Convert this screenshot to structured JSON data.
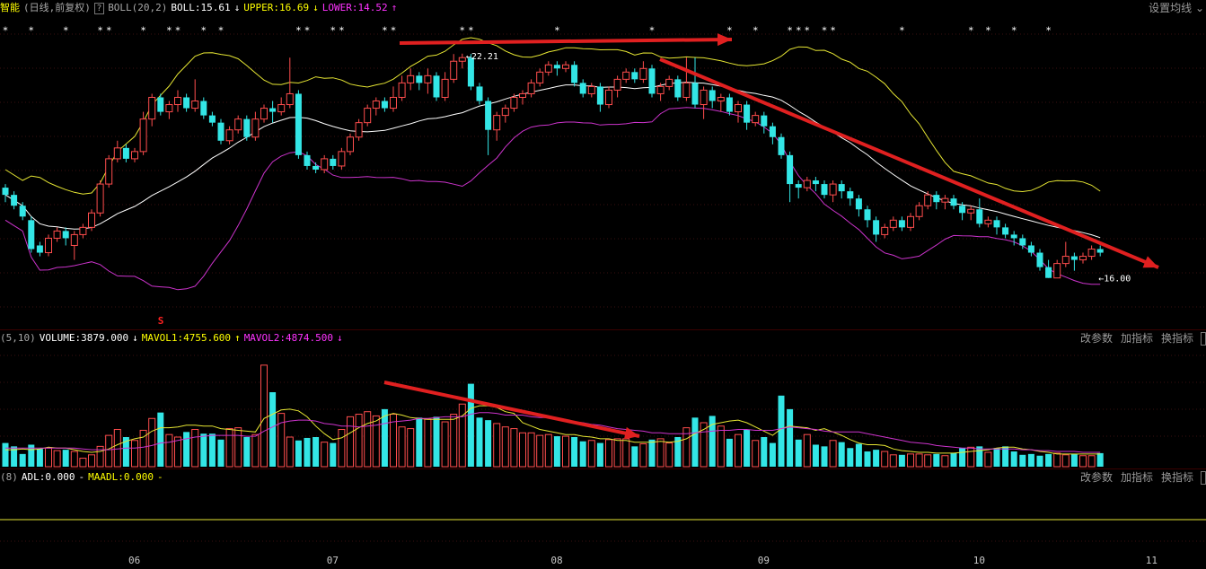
{
  "header": {
    "stock_name": "智能",
    "period": "(日线,前复权)",
    "help": "?",
    "indicator": "BOLL(20,2)",
    "boll": "BOLL:15.61",
    "boll_arrow": "↓",
    "upper": "UPPER:16.69",
    "upper_arrow": "↓",
    "lower": "LOWER:14.52",
    "lower_arrow": "↑",
    "settings": "设置均线"
  },
  "annotations": {
    "high_label": "22.21",
    "low_label": "16.00",
    "signal_mark": "S"
  },
  "volume_header": {
    "params": "(5,10)",
    "volume": "VOLUME:3879.000",
    "volume_arrow": "↓",
    "mavol1": "MAVOL1:4755.600",
    "mavol1_arrow": "↑",
    "mavol2": "MAVOL2:4874.500",
    "mavol2_arrow": "↓",
    "btn_params": "改参数",
    "btn_add": "加指标",
    "btn_switch": "换指标"
  },
  "adl_header": {
    "params": "(8)",
    "adl": "ADL:0.000",
    "dash1": "-",
    "maadl": "MAADL:0.000",
    "dash2": "-",
    "btn_params": "改参数",
    "btn_add": "加指标",
    "btn_switch": "换指标"
  },
  "x_axis": {
    "labels": [
      "06",
      "07",
      "08",
      "09",
      "10",
      "11"
    ]
  },
  "colors": {
    "up": "#ff4d4d",
    "down": "#33e6e6",
    "mid": "#ffffff",
    "upper": "#e6e633",
    "lower": "#cc33cc",
    "arrow": "#e02020",
    "star": "#ffffff"
  },
  "chart_data": {
    "type": "candlestick",
    "indicator": "BOLL(20,2)",
    "price_range": [
      14.8,
      23.0
    ],
    "high": 22.21,
    "low": 16.0,
    "candles": [
      [
        18.5,
        18.3,
        18.6,
        18.1
      ],
      [
        18.3,
        18.0,
        18.4,
        17.9
      ],
      [
        18.0,
        17.7,
        18.1,
        17.6
      ],
      [
        17.6,
        16.8,
        17.7,
        16.7
      ],
      [
        16.9,
        16.7,
        17.0,
        16.6
      ],
      [
        16.7,
        17.1,
        17.2,
        16.6
      ],
      [
        17.1,
        17.3,
        17.4,
        17.0
      ],
      [
        17.3,
        17.1,
        17.4,
        16.9
      ],
      [
        16.9,
        17.2,
        17.3,
        16.5
      ],
      [
        17.2,
        17.4,
        17.5,
        17.1
      ],
      [
        17.4,
        17.8,
        17.9,
        17.3
      ],
      [
        17.8,
        18.6,
        18.7,
        17.7
      ],
      [
        18.6,
        19.3,
        19.4,
        18.5
      ],
      [
        19.3,
        19.6,
        19.8,
        19.2
      ],
      [
        19.6,
        19.3,
        19.7,
        19.2
      ],
      [
        19.3,
        19.5,
        19.6,
        19.2
      ],
      [
        19.5,
        20.4,
        20.6,
        19.4
      ],
      [
        20.4,
        21.0,
        21.1,
        20.2
      ],
      [
        21.0,
        20.6,
        21.1,
        20.5
      ],
      [
        20.6,
        20.8,
        20.9,
        20.4
      ],
      [
        20.8,
        21.0,
        21.2,
        20.6
      ],
      [
        21.0,
        20.7,
        21.1,
        20.6
      ],
      [
        20.7,
        20.9,
        21.5,
        20.6
      ],
      [
        20.9,
        20.5,
        21.0,
        20.4
      ],
      [
        20.5,
        20.3,
        20.6,
        20.2
      ],
      [
        20.3,
        19.8,
        20.4,
        19.7
      ],
      [
        19.8,
        20.1,
        20.2,
        19.7
      ],
      [
        20.1,
        20.4,
        20.5,
        20.0
      ],
      [
        20.4,
        19.9,
        20.5,
        19.8
      ],
      [
        19.9,
        20.4,
        20.6,
        19.8
      ],
      [
        20.4,
        20.7,
        20.8,
        20.3
      ],
      [
        20.7,
        20.6,
        20.9,
        20.3
      ],
      [
        20.6,
        20.8,
        21.0,
        20.5
      ],
      [
        20.8,
        21.1,
        22.1,
        20.7
      ],
      [
        21.1,
        19.4,
        21.2,
        19.3
      ],
      [
        19.4,
        19.1,
        19.5,
        19.0
      ],
      [
        19.1,
        19.0,
        19.2,
        18.9
      ],
      [
        19.0,
        19.3,
        19.4,
        18.9
      ],
      [
        19.3,
        19.1,
        19.4,
        19.0
      ],
      [
        19.1,
        19.5,
        19.6,
        19.0
      ],
      [
        19.5,
        19.9,
        20.0,
        19.4
      ],
      [
        19.9,
        20.3,
        20.4,
        19.8
      ],
      [
        20.3,
        20.7,
        20.8,
        20.2
      ],
      [
        20.7,
        20.9,
        21.0,
        20.5
      ],
      [
        20.9,
        20.7,
        21.0,
        20.6
      ],
      [
        20.7,
        21.0,
        21.3,
        20.6
      ],
      [
        21.0,
        21.4,
        21.6,
        20.9
      ],
      [
        21.4,
        21.6,
        21.8,
        21.2
      ],
      [
        21.6,
        21.4,
        21.7,
        21.2
      ],
      [
        21.4,
        21.6,
        21.8,
        21.1
      ],
      [
        21.6,
        21.0,
        21.7,
        20.9
      ],
      [
        21.0,
        21.5,
        21.7,
        20.9
      ],
      [
        21.5,
        22.0,
        22.2,
        21.4
      ],
      [
        22.0,
        22.1,
        22.21,
        21.8
      ],
      [
        22.1,
        21.3,
        22.2,
        21.2
      ],
      [
        21.3,
        20.9,
        21.4,
        20.8
      ],
      [
        20.9,
        20.1,
        21.0,
        19.4
      ],
      [
        20.1,
        20.5,
        20.6,
        19.8
      ],
      [
        20.5,
        20.7,
        20.8,
        20.3
      ],
      [
        20.7,
        21.0,
        21.1,
        20.6
      ],
      [
        21.0,
        21.1,
        21.2,
        20.8
      ],
      [
        21.1,
        21.4,
        21.5,
        21.0
      ],
      [
        21.4,
        21.7,
        21.8,
        21.3
      ],
      [
        21.7,
        21.9,
        22.0,
        21.6
      ],
      [
        21.9,
        21.8,
        22.0,
        21.6
      ],
      [
        21.8,
        21.9,
        22.0,
        21.7
      ],
      [
        21.9,
        21.4,
        22.0,
        21.3
      ],
      [
        21.4,
        21.1,
        21.5,
        21.0
      ],
      [
        21.1,
        21.3,
        21.4,
        21.0
      ],
      [
        21.3,
        20.8,
        21.4,
        20.6
      ],
      [
        20.8,
        21.2,
        21.3,
        20.7
      ],
      [
        21.2,
        21.5,
        21.6,
        21.0
      ],
      [
        21.5,
        21.7,
        21.8,
        21.4
      ],
      [
        21.7,
        21.5,
        21.8,
        21.4
      ],
      [
        21.5,
        21.8,
        22.0,
        21.4
      ],
      [
        21.8,
        21.1,
        21.9,
        21.0
      ],
      [
        21.1,
        21.3,
        21.4,
        20.9
      ],
      [
        21.3,
        21.5,
        21.6,
        21.2
      ],
      [
        21.5,
        21.0,
        21.6,
        20.9
      ],
      [
        21.0,
        21.4,
        22.1,
        20.9
      ],
      [
        21.4,
        20.8,
        22.1,
        20.7
      ],
      [
        20.8,
        21.2,
        21.3,
        20.4
      ],
      [
        21.2,
        20.9,
        21.3,
        20.7
      ],
      [
        20.9,
        21.0,
        21.1,
        20.6
      ],
      [
        21.0,
        20.6,
        21.1,
        20.5
      ],
      [
        20.6,
        20.8,
        20.9,
        20.3
      ],
      [
        20.8,
        20.3,
        20.9,
        20.1
      ],
      [
        20.3,
        20.5,
        20.6,
        20.2
      ],
      [
        20.5,
        20.2,
        20.6,
        20.0
      ],
      [
        20.2,
        19.9,
        20.3,
        19.7
      ],
      [
        19.9,
        19.4,
        20.0,
        19.3
      ],
      [
        19.4,
        18.6,
        19.5,
        18.1
      ],
      [
        18.6,
        18.5,
        18.7,
        18.2
      ],
      [
        18.5,
        18.7,
        18.8,
        18.4
      ],
      [
        18.7,
        18.6,
        18.8,
        18.4
      ],
      [
        18.6,
        18.3,
        18.7,
        18.2
      ],
      [
        18.3,
        18.6,
        18.7,
        18.1
      ],
      [
        18.6,
        18.4,
        18.7,
        18.2
      ],
      [
        18.4,
        18.2,
        18.5,
        18.0
      ],
      [
        18.2,
        17.9,
        18.3,
        17.7
      ],
      [
        17.9,
        17.6,
        18.0,
        17.4
      ],
      [
        17.6,
        17.2,
        17.7,
        17.0
      ],
      [
        17.2,
        17.4,
        17.5,
        17.1
      ],
      [
        17.4,
        17.6,
        17.7,
        17.3
      ],
      [
        17.6,
        17.4,
        17.7,
        17.3
      ],
      [
        17.4,
        17.7,
        17.8,
        17.3
      ],
      [
        17.7,
        18.0,
        18.1,
        17.6
      ],
      [
        18.0,
        18.3,
        18.4,
        17.9
      ],
      [
        18.3,
        18.1,
        18.4,
        17.9
      ],
      [
        18.1,
        18.2,
        18.3,
        17.9
      ],
      [
        18.2,
        18.0,
        18.3,
        17.9
      ],
      [
        18.0,
        17.8,
        18.1,
        17.6
      ],
      [
        17.8,
        17.9,
        18.0,
        17.6
      ],
      [
        17.9,
        17.5,
        18.2,
        17.4
      ],
      [
        17.5,
        17.6,
        17.7,
        17.4
      ],
      [
        17.6,
        17.4,
        17.7,
        17.2
      ],
      [
        17.4,
        17.2,
        17.5,
        17.1
      ],
      [
        17.2,
        17.1,
        17.3,
        16.9
      ],
      [
        17.1,
        16.9,
        17.2,
        16.8
      ],
      [
        16.9,
        16.7,
        17.0,
        16.6
      ],
      [
        16.7,
        16.3,
        16.8,
        16.2
      ],
      [
        16.3,
        16.0,
        16.5,
        16.0
      ],
      [
        16.0,
        16.4,
        16.5,
        16.0
      ],
      [
        16.4,
        16.6,
        17.0,
        16.3
      ],
      [
        16.6,
        16.5,
        16.7,
        16.2
      ],
      [
        16.5,
        16.6,
        16.7,
        16.4
      ],
      [
        16.6,
        16.8,
        16.9,
        16.5
      ],
      [
        16.8,
        16.7,
        16.9,
        16.6
      ]
    ],
    "volume_range": [
      0,
      14000
    ],
    "volumes": [
      2800,
      2400,
      1500,
      2600,
      2100,
      2200,
      1900,
      2000,
      1800,
      1000,
      1400,
      2400,
      3700,
      4400,
      3500,
      3100,
      4300,
      5700,
      6400,
      3800,
      3500,
      4100,
      4400,
      3900,
      3900,
      3200,
      4500,
      4600,
      3500,
      3800,
      12000,
      8800,
      6300,
      3500,
      3100,
      3400,
      3500,
      2900,
      2800,
      4400,
      5900,
      6200,
      6500,
      6000,
      6800,
      6200,
      4700,
      4500,
      5800,
      5600,
      5900,
      5300,
      6200,
      7400,
      9800,
      5800,
      5500,
      5100,
      4700,
      4500,
      4000,
      4000,
      3700,
      3800,
      3600,
      3600,
      3500,
      3000,
      3100,
      2800,
      3200,
      3300,
      3300,
      2400,
      2700,
      3200,
      3300,
      2800,
      3500,
      4600,
      5800,
      5200,
      6000,
      4800,
      3300,
      3800,
      4400,
      3100,
      3500,
      2800,
      8400,
      6800,
      3200,
      3800,
      2600,
      2400,
      3100,
      2900,
      2200,
      2700,
      1800,
      2000,
      1800,
      1400,
      1400,
      1500,
      1500,
      1400,
      1500,
      1300,
      1600,
      2200,
      2300,
      2400,
      1700,
      2200,
      2400,
      1800,
      1400,
      1500,
      1300,
      1500,
      1600,
      1400,
      1500,
      1300,
      1300,
      1600,
      2000,
      2100,
      1800,
      1300,
      1500,
      1800,
      2000,
      1800
    ],
    "mavol1": [
      2000,
      2000,
      2100,
      2000,
      2100,
      2300,
      2200,
      2200,
      2000,
      1800,
      1700,
      1800,
      2100,
      2600,
      3000,
      3300,
      3500,
      4200,
      4600,
      4600,
      4700,
      4900,
      4900,
      4800,
      4800,
      4500,
      4400,
      4300,
      4200,
      4100,
      5700,
      6200,
      6700,
      6800,
      6600,
      5900,
      4800,
      3900,
      3200,
      3400,
      4000,
      4600,
      5100,
      5400,
      6000,
      6300,
      6100,
      5800,
      5700,
      5600,
      5600,
      5600,
      5600,
      6000,
      6900,
      7200,
      7200,
      7000,
      6500,
      6300,
      5200,
      4800,
      4400,
      4200,
      4000,
      3800,
      3800,
      3600,
      3500,
      3300,
      3300,
      3100,
      3100,
      2900,
      2900,
      2900,
      3000,
      2900,
      3000,
      3300,
      3900,
      4400,
      5000,
      5200,
      5400,
      5500,
      5200,
      4700,
      4200,
      3700,
      4500,
      4800,
      4700,
      4600,
      4300,
      4500,
      4100,
      3700,
      3200,
      2800,
      2600,
      2600,
      2500,
      2100,
      1900,
      1800,
      1700,
      1700,
      1600,
      1600,
      1600,
      1700,
      1800,
      1900,
      2000,
      2200,
      2300,
      2300,
      2100,
      2000,
      1800,
      1700,
      1500,
      1500,
      1500,
      1500,
      1500,
      1500,
      1600,
      1700,
      1700,
      1700,
      1700,
      1700,
      1700,
      1700
    ],
    "mavol2": [
      2200,
      2200,
      2200,
      2200,
      2200,
      2200,
      2200,
      2200,
      2200,
      2100,
      2000,
      2000,
      2000,
      2100,
      2200,
      2200,
      2300,
      2500,
      2800,
      2900,
      3100,
      3300,
      3500,
      3600,
      3700,
      3700,
      3700,
      3700,
      3600,
      3600,
      4200,
      4700,
      5200,
      5400,
      5500,
      5500,
      5400,
      5100,
      5000,
      4800,
      4800,
      4700,
      4800,
      4900,
      5100,
      5300,
      5400,
      5500,
      5700,
      5700,
      5800,
      5900,
      5900,
      5900,
      6200,
      6400,
      6400,
      6300,
      6100,
      6100,
      6100,
      5900,
      5800,
      5800,
      5700,
      5500,
      5300,
      5200,
      5000,
      4900,
      4700,
      4500,
      4400,
      4300,
      4200,
      4000,
      4000,
      3900,
      3900,
      3900,
      4000,
      4100,
      4200,
      4300,
      4300,
      4400,
      4400,
      4300,
      4300,
      4300,
      4500,
      4700,
      4600,
      4500,
      4400,
      4200,
      4100,
      4100,
      4100,
      4100,
      3900,
      3700,
      3500,
      3300,
      3100,
      2900,
      2800,
      2700,
      2500,
      2400,
      2300,
      2200,
      2200,
      2100,
      2100,
      2100,
      2100,
      2100,
      2000,
      2000,
      1900,
      1900,
      1800,
      1800,
      1800,
      1700,
      1700,
      1700,
      1700,
      1700,
      1700,
      1700,
      1700,
      1700,
      1700,
      1700
    ],
    "adl": 0.0,
    "maadl": 0.0,
    "x_ticks": [
      "06",
      "07",
      "08",
      "09",
      "10",
      "11"
    ]
  }
}
